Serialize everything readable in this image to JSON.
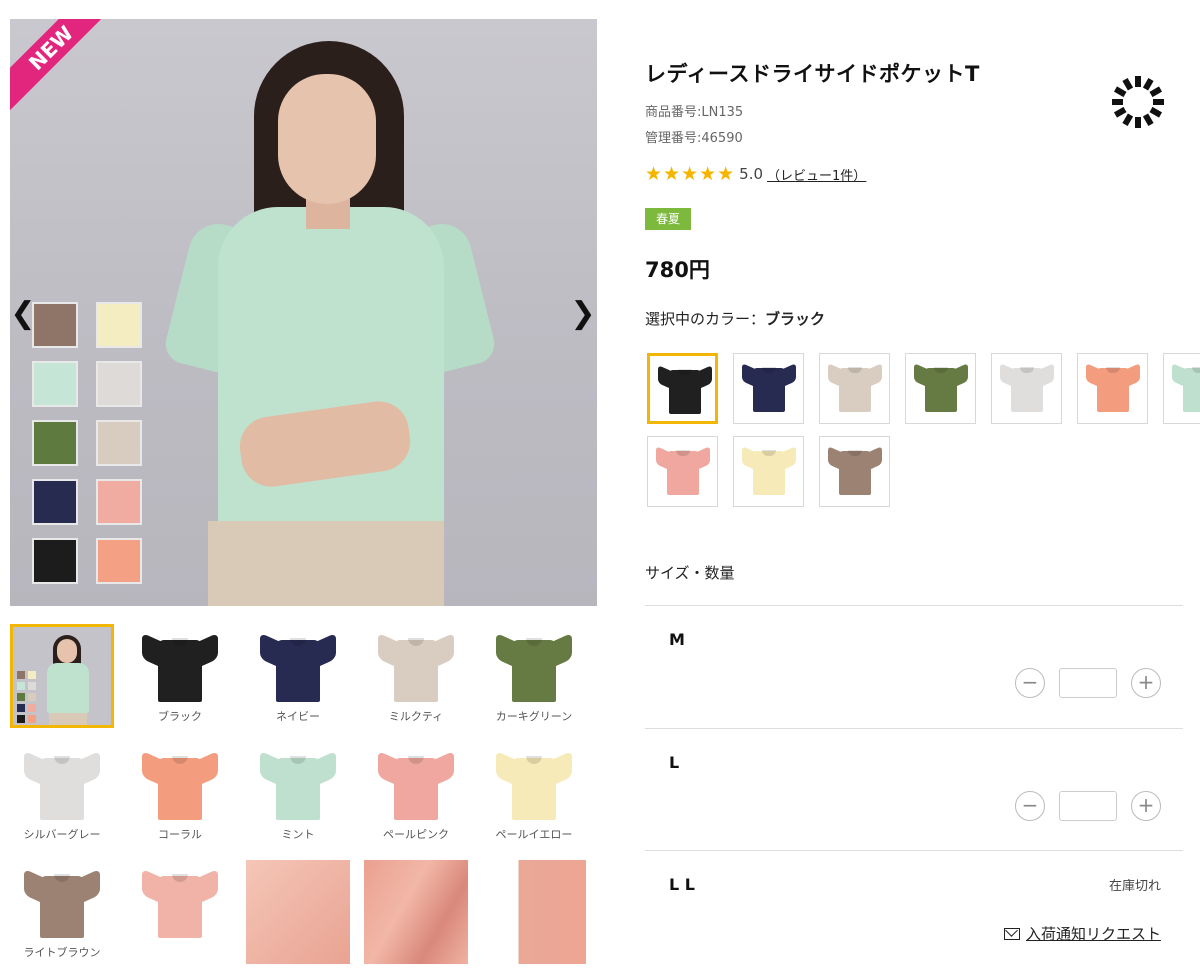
{
  "product": {
    "badge": "NEW",
    "title": "レディースドライサイドポケットT",
    "item_number": "商品番号:LN135",
    "management_number": "管理番号:46590",
    "rating": {
      "stars": "★★★★★",
      "value": 5.0,
      "value_text": "5.0",
      "reviews_label": "（レビュー1件）"
    },
    "season_tag": "春夏",
    "price": "780円"
  },
  "gallery": {
    "prev_icon": "❮",
    "next_icon": "❯",
    "main_swatches": [
      "#8e7568",
      "#f5edc2",
      "#c5e6d6",
      "#dedad7",
      "#5f7a3e",
      "#d8cbc0",
      "#262b4f",
      "#f0aca0",
      "#1c1c1c",
      "#f3a085"
    ],
    "thumbnails": [
      {
        "type": "model",
        "caption": ""
      },
      {
        "type": "tee",
        "color": "#202020",
        "caption": "ブラック"
      },
      {
        "type": "tee",
        "color": "#272b52",
        "caption": "ネイビー"
      },
      {
        "type": "tee",
        "color": "#d9cdc2",
        "caption": "ミルクティ"
      },
      {
        "type": "tee",
        "color": "#667b43",
        "caption": "カーキグリーン"
      },
      {
        "type": "tee",
        "color": "#e0dedd",
        "caption": "シルバーグレー"
      },
      {
        "type": "tee",
        "color": "#f39c7e",
        "caption": "コーラル"
      },
      {
        "type": "tee",
        "color": "#bfe0cf",
        "caption": "ミント"
      },
      {
        "type": "tee",
        "color": "#efa7a0",
        "caption": "ペールピンク"
      },
      {
        "type": "tee",
        "color": "#f5eab8",
        "caption": "ペールイエロー"
      },
      {
        "type": "tee",
        "color": "#9b8273",
        "caption": "ライトブラウン"
      },
      {
        "type": "tee",
        "color": "#f1b2a8",
        "caption": ""
      },
      {
        "type": "fabric",
        "caption": ""
      },
      {
        "type": "fabric2",
        "caption": ""
      },
      {
        "type": "fabric3",
        "caption": ""
      }
    ]
  },
  "color_select": {
    "label_prefix": "選択中のカラー：",
    "selected_name": "ブラック",
    "selected_index": 0,
    "swatches": [
      "#202020",
      "#272b52",
      "#d9cdc2",
      "#667b43",
      "#e0dedd",
      "#f39c7e",
      "#bfe0cf",
      "#efa7a0",
      "#f5eab8",
      "#9b8273"
    ]
  },
  "sizes": {
    "heading": "サイズ・数量",
    "rows": [
      {
        "name": "M",
        "in_stock": true,
        "qty": ""
      },
      {
        "name": "L",
        "in_stock": true,
        "qty": ""
      },
      {
        "name": "L L",
        "in_stock": false,
        "status": "在庫切れ",
        "notify_label": "入荷通知リクエスト"
      }
    ],
    "minus_label": "−",
    "plus_label": "+"
  },
  "colors": {
    "accent_border": "#f2b705",
    "badge": "#e2267e",
    "season_tag": "#7cb93c",
    "stars": "#f5b400"
  }
}
